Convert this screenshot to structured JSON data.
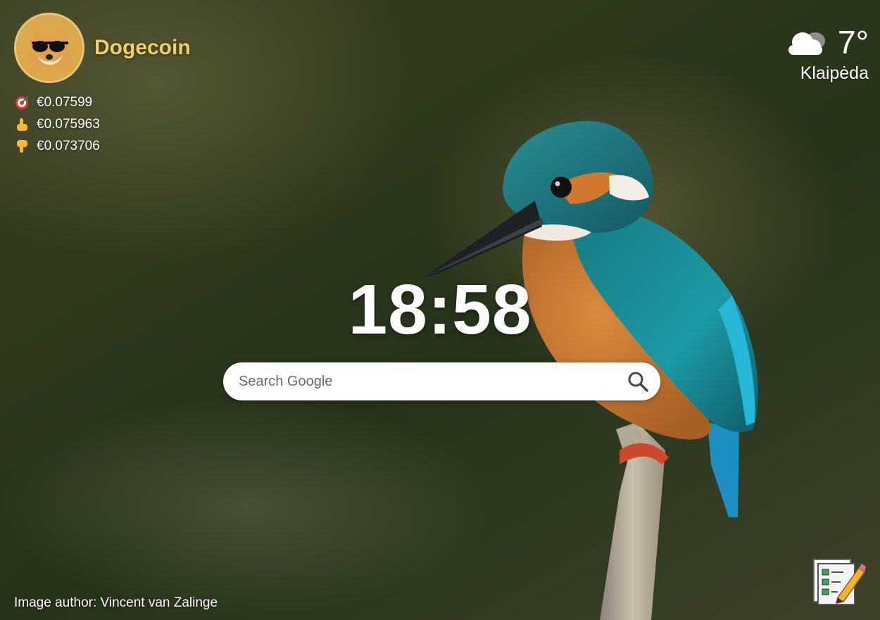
{
  "crypto": {
    "name": "Dogecoin",
    "prices": [
      {
        "icon": "target-icon",
        "value": "€0.07599"
      },
      {
        "icon": "pointing-up-icon",
        "value": "€0.075963"
      },
      {
        "icon": "pointing-down-icon",
        "value": "€0.073706"
      }
    ]
  },
  "weather": {
    "icon": "cloud-icon",
    "temperature": "7°",
    "city": "Klaipėda"
  },
  "clock": {
    "time": "18:58"
  },
  "search": {
    "placeholder": "Search Google",
    "icon": "search-icon"
  },
  "footer": {
    "credit": "Image author: Vincent van Zalinge",
    "todo_icon": "todo-list-icon"
  },
  "colors": {
    "coin_name": "#f0cf6a",
    "text": "#ffffff",
    "search_bg": "#ffffff"
  }
}
